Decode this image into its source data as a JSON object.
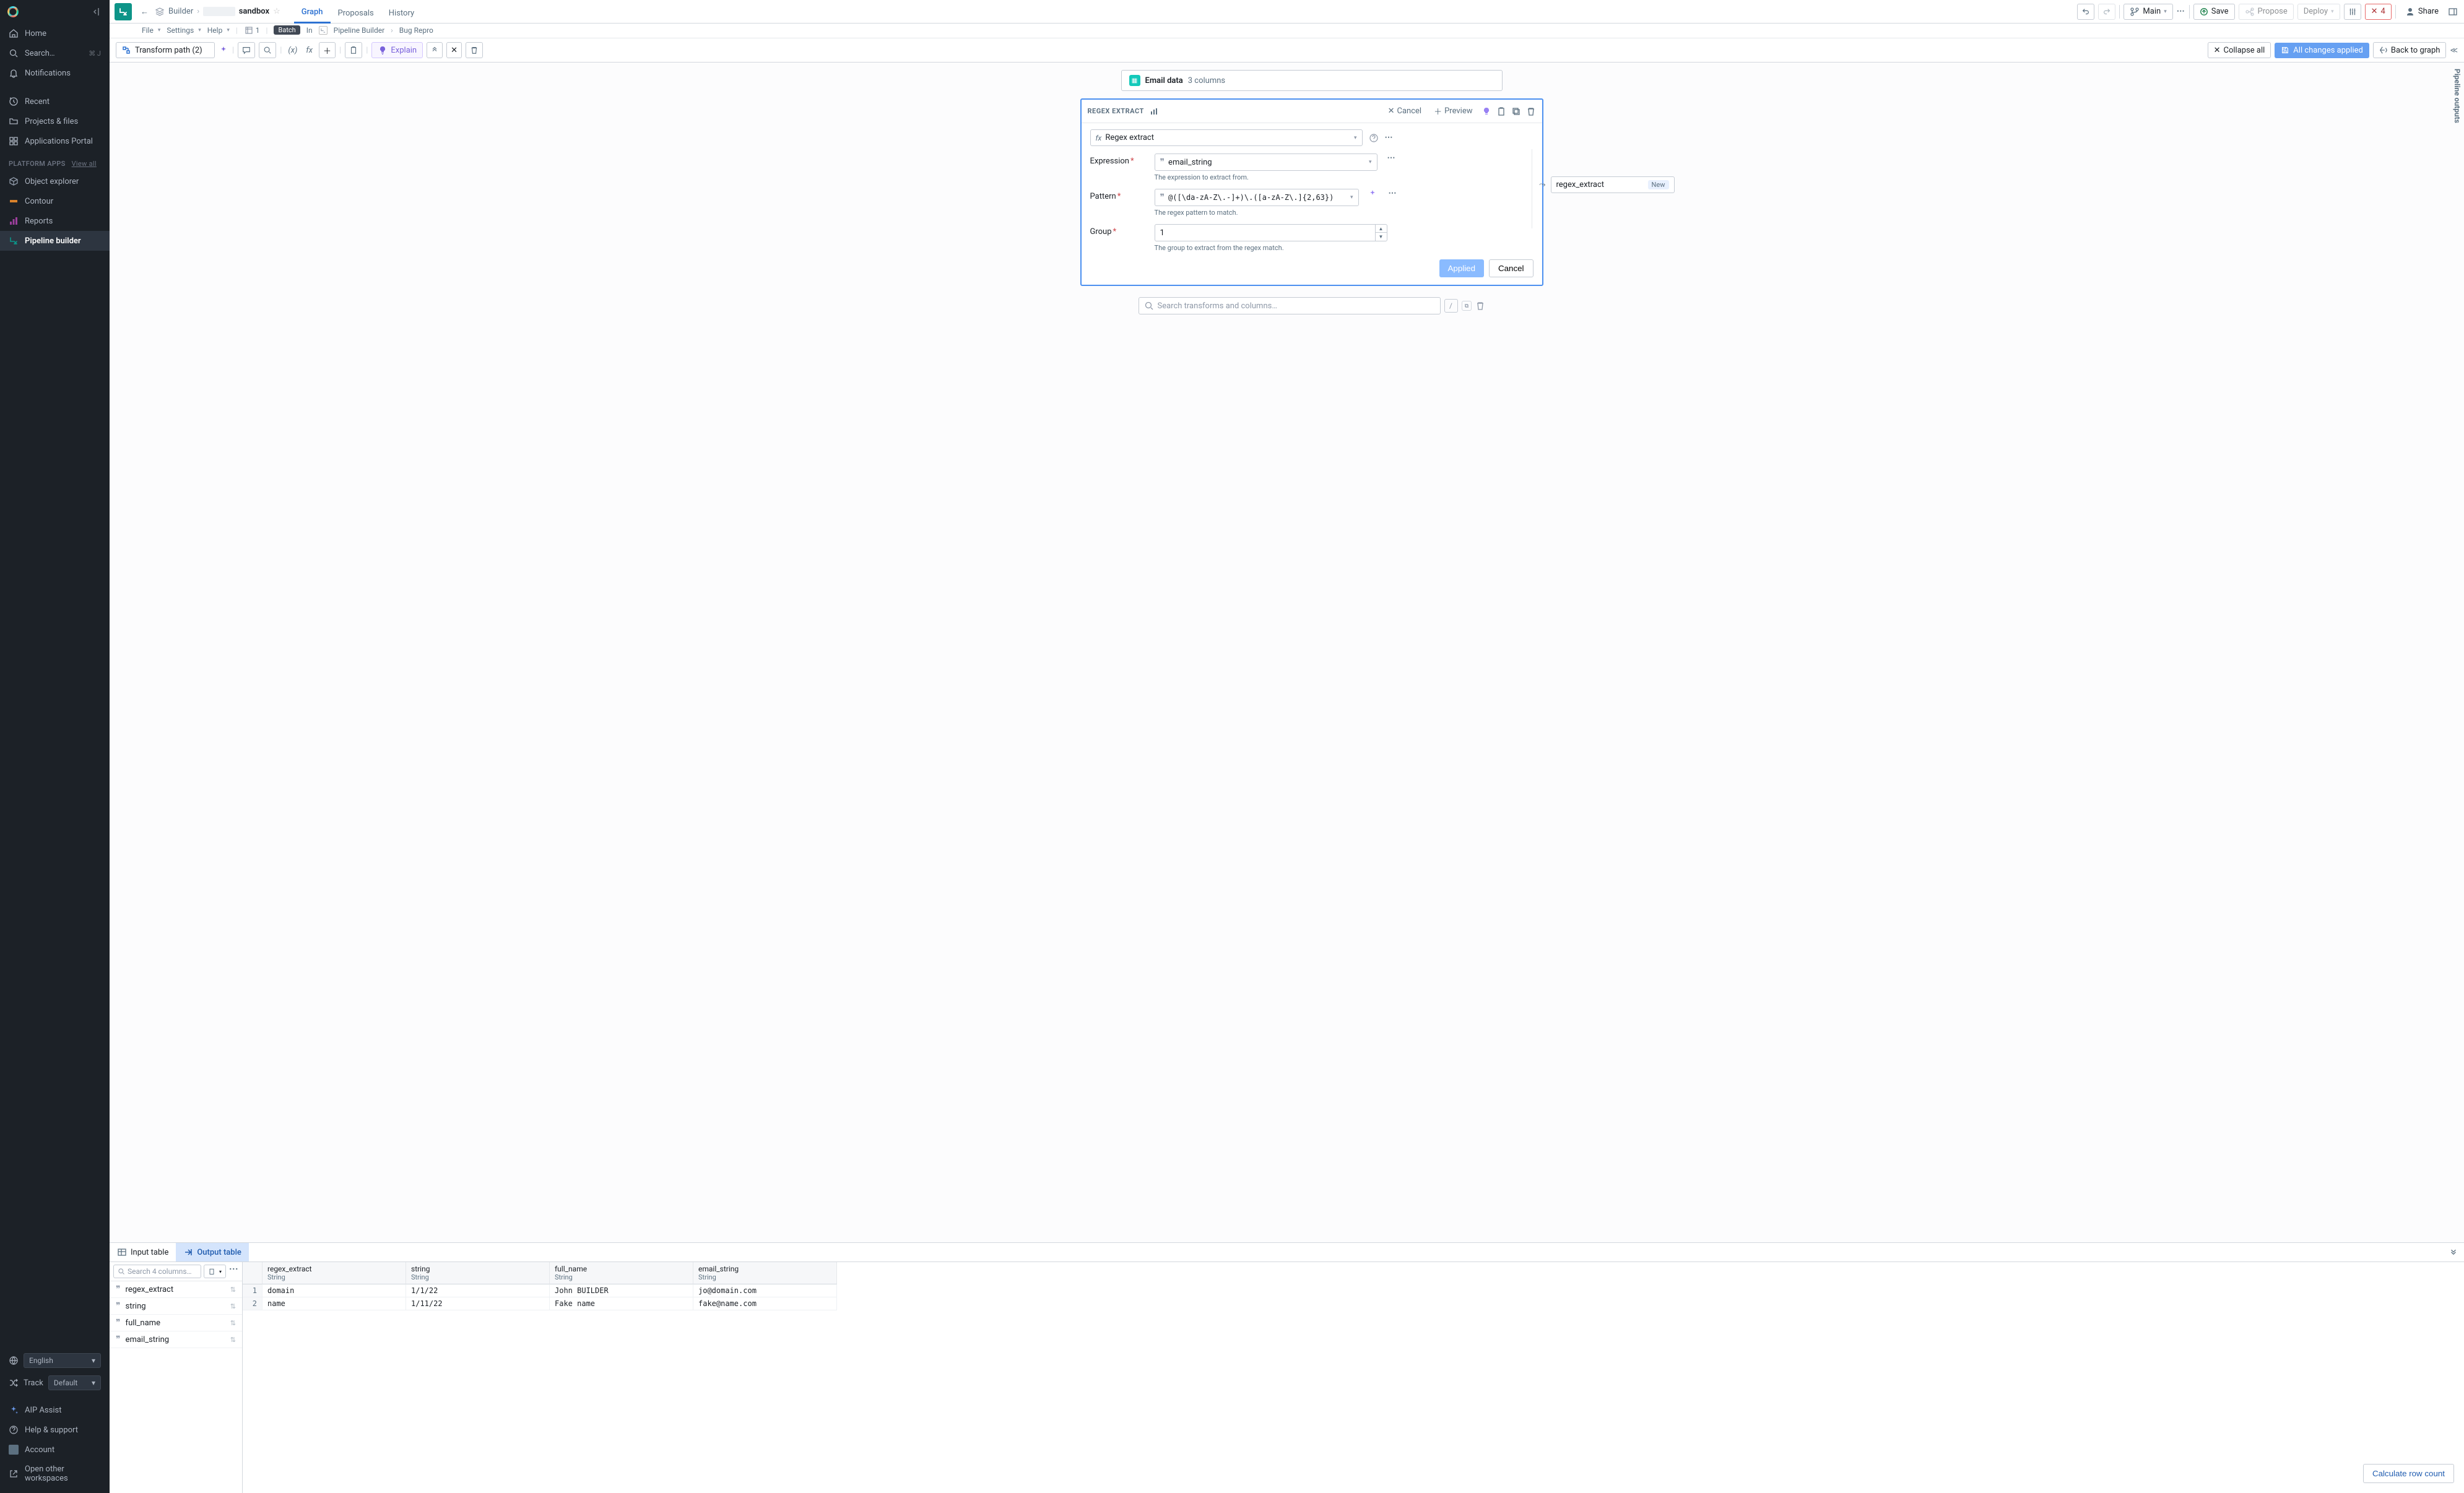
{
  "sidebar": {
    "home": "Home",
    "search": "Search…",
    "search_kbd": "⌘ J",
    "notifications": "Notifications",
    "recent": "Recent",
    "projects": "Projects & files",
    "portal": "Applications Portal",
    "section": "PLATFORM APPS",
    "view_all": "View all",
    "apps": {
      "object_explorer": "Object explorer",
      "contour": "Contour",
      "reports": "Reports",
      "pipeline_builder": "Pipeline builder"
    },
    "language": "English",
    "track_label": "Track",
    "track_value": "Default",
    "aip": "AIP Assist",
    "help": "Help & support",
    "account": "Account",
    "open_other": "Open other workspaces"
  },
  "topbar": {
    "builder": "Builder",
    "sandbox": "sandbox",
    "tabs": {
      "graph": "Graph",
      "proposals": "Proposals",
      "history": "History"
    },
    "branch": "Main",
    "save": "Save",
    "propose": "Propose",
    "deploy": "Deploy",
    "error_count": "4",
    "share": "Share"
  },
  "menubar": {
    "file": "File",
    "settings": "Settings",
    "help": "Help",
    "frame_count": "1",
    "batch": "Batch",
    "in": "In",
    "pb": "Pipeline Builder",
    "bug": "Bug Repro"
  },
  "toolbar": {
    "transform_path": "Transform path (2)",
    "explain": "Explain",
    "collapse_all": "Collapse all",
    "all_applied": "All changes applied",
    "back_to_graph": "Back to graph"
  },
  "email_node": {
    "title": "Email data",
    "sub": "3 columns"
  },
  "regex_node": {
    "title": "REGEX EXTRACT",
    "cancel": "Cancel",
    "preview": "Preview",
    "fx_name": "Regex extract",
    "expression_label": "Expression",
    "expression_value": "email_string",
    "expression_help": "The expression to extract from.",
    "pattern_label": "Pattern",
    "pattern_value": "@([\\da-zA-Z\\.-]+)\\.([a-zA-Z\\.]{2,63})",
    "pattern_help": "The regex pattern to match.",
    "group_label": "Group",
    "group_value": "1",
    "group_help": "The group to extract from the regex match.",
    "output": "regex_extract",
    "new": "New",
    "applied": "Applied",
    "cancel_btn": "Cancel"
  },
  "search_transforms": {
    "placeholder": "Search transforms and columns…",
    "slash": "/"
  },
  "pipeline_outputs": "Pipeline outputs",
  "bottom": {
    "input_tab": "Input table",
    "output_tab": "Output table",
    "search_placeholder": "Search 4 columns…",
    "columns": [
      "regex_extract",
      "string",
      "full_name",
      "email_string"
    ],
    "headers": [
      {
        "name": "regex_extract",
        "type": "String"
      },
      {
        "name": "string",
        "type": "String"
      },
      {
        "name": "full_name",
        "type": "String"
      },
      {
        "name": "email_string",
        "type": "String"
      }
    ],
    "rows": [
      {
        "n": "1",
        "c0": "domain",
        "c1": "1/1/22",
        "c2": "John BUILDER",
        "c3": "jo@domain.com"
      },
      {
        "n": "2",
        "c0": "name",
        "c1": "1/11/22",
        "c2": "Fake name",
        "c3": "fake@name.com"
      }
    ],
    "calc": "Calculate row count"
  }
}
